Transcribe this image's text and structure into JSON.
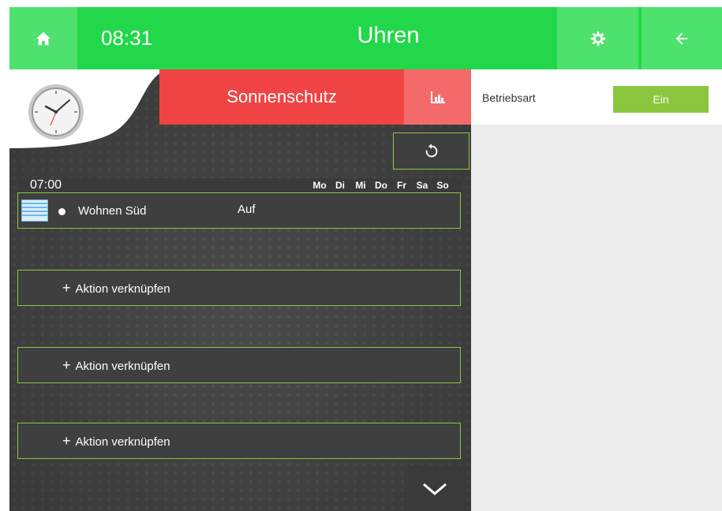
{
  "topbar": {
    "time": "08:31",
    "title": "Uhren"
  },
  "profile": {
    "header_label": "Sonnenschutz"
  },
  "schedule": {
    "time": "07:00",
    "days": [
      "Mo",
      "Di",
      "Mi",
      "Do",
      "Fr",
      "Sa",
      "So"
    ],
    "entry": {
      "name": "Wohnen Süd",
      "action": "Auf"
    },
    "add_actions": [
      {
        "label": "Aktion verknüpfen"
      },
      {
        "label": "Aktion verknüpfen"
      },
      {
        "label": "Aktion verknüpfen"
      }
    ]
  },
  "settings": {
    "mode_label": "Betriebsart",
    "mode_value": "Ein"
  },
  "icons": {
    "home": "home-icon",
    "settings": "gear-refresh-icon",
    "back": "arrow-left-icon",
    "clock": "clock-icon",
    "chart": "bar-chart-icon",
    "reset": "reset-icon",
    "blind": "blind-icon",
    "down": "chevron-down-icon"
  },
  "colors": {
    "primary_green": "#22d84a",
    "light_green": "#4ee16d",
    "accent_red": "#f04444",
    "border_green": "#8cc63f",
    "panel_bg": "#4a4a4a"
  }
}
